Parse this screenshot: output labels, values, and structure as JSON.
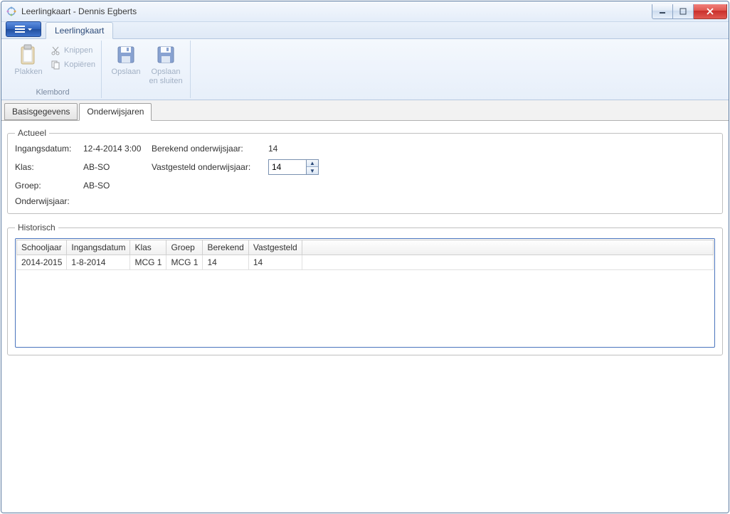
{
  "window": {
    "title": "Leerlingkaart - Dennis Egberts"
  },
  "ribbon": {
    "tab_label": "Leerlingkaart",
    "groups": {
      "klembord": {
        "label": "Klembord",
        "paste": "Plakken",
        "cut": "Knippen",
        "copy": "Kopiëren"
      },
      "save_group": {
        "save": "Opslaan",
        "save_close": "Opslaan en sluiten"
      }
    }
  },
  "subtabs": {
    "basisgegevens": "Basisgegevens",
    "onderwijsjaren": "Onderwijsjaren"
  },
  "actueel": {
    "legend": "Actueel",
    "labels": {
      "ingangsdatum": "Ingangsdatum:",
      "klas": "Klas:",
      "groep": "Groep:",
      "onderwijsjaar": "Onderwijsjaar:",
      "berekend": "Berekend onderwijsjaar:",
      "vastgesteld": "Vastgesteld onderwijsjaar:"
    },
    "values": {
      "ingangsdatum": "12-4-2014 3:00",
      "klas": "AB-SO",
      "groep": "AB-SO",
      "onderwijsjaar": "",
      "berekend": "14",
      "vastgesteld": "14"
    }
  },
  "historisch": {
    "legend": "Historisch",
    "headers": {
      "schooljaar": "Schooljaar",
      "ingangsdatum": "Ingangsdatum",
      "klas": "Klas",
      "groep": "Groep",
      "berekend": "Berekend",
      "vastgesteld": "Vastgesteld"
    },
    "rows": [
      {
        "schooljaar": "2014-2015",
        "ingangsdatum": "1-8-2014",
        "klas": "MCG 1",
        "groep": "MCG 1",
        "berekend": "14",
        "vastgesteld": "14"
      }
    ]
  }
}
